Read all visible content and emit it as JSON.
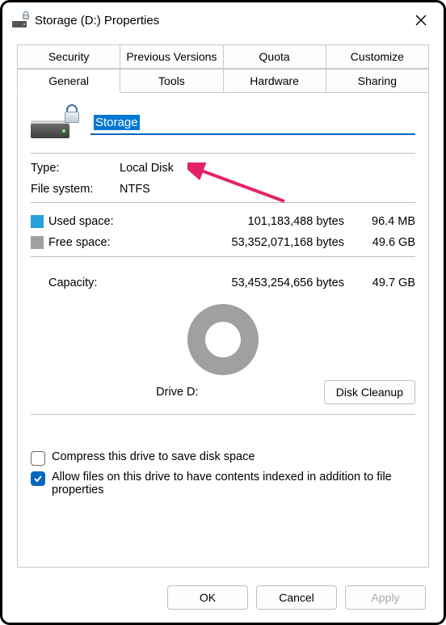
{
  "window": {
    "title": "Storage (D:) Properties"
  },
  "tabs": {
    "row1": [
      "Security",
      "Previous Versions",
      "Quota",
      "Customize"
    ],
    "row2": [
      "General",
      "Tools",
      "Hardware",
      "Sharing"
    ],
    "active": "General"
  },
  "general": {
    "drive_name": "Storage",
    "type_label": "Type:",
    "type_value": "Local Disk",
    "fs_label": "File system:",
    "fs_value": "NTFS",
    "used_label": "Used space:",
    "used_bytes": "101,183,488 bytes",
    "used_hr": "96.4 MB",
    "free_label": "Free space:",
    "free_bytes": "53,352,071,168 bytes",
    "free_hr": "49.6 GB",
    "capacity_label": "Capacity:",
    "capacity_bytes": "53,453,254,656 bytes",
    "capacity_hr": "49.7 GB",
    "drive_label": "Drive D:",
    "disk_cleanup": "Disk Cleanup",
    "compress_label": "Compress this drive to save disk space",
    "compress_checked": false,
    "index_label": "Allow files on this drive to have contents indexed in addition to file properties",
    "index_checked": true
  },
  "buttons": {
    "ok": "OK",
    "cancel": "Cancel",
    "apply": "Apply"
  },
  "colors": {
    "used": "#26a0da",
    "free": "#a0a0a0",
    "accent": "#0067c0",
    "arrow": "#e3226a"
  },
  "chart_data": {
    "type": "pie",
    "title": "Drive D:",
    "series": [
      {
        "name": "Used space",
        "value": 101183488,
        "color": "#26a0da"
      },
      {
        "name": "Free space",
        "value": 53352071168,
        "color": "#a0a0a0"
      }
    ]
  }
}
